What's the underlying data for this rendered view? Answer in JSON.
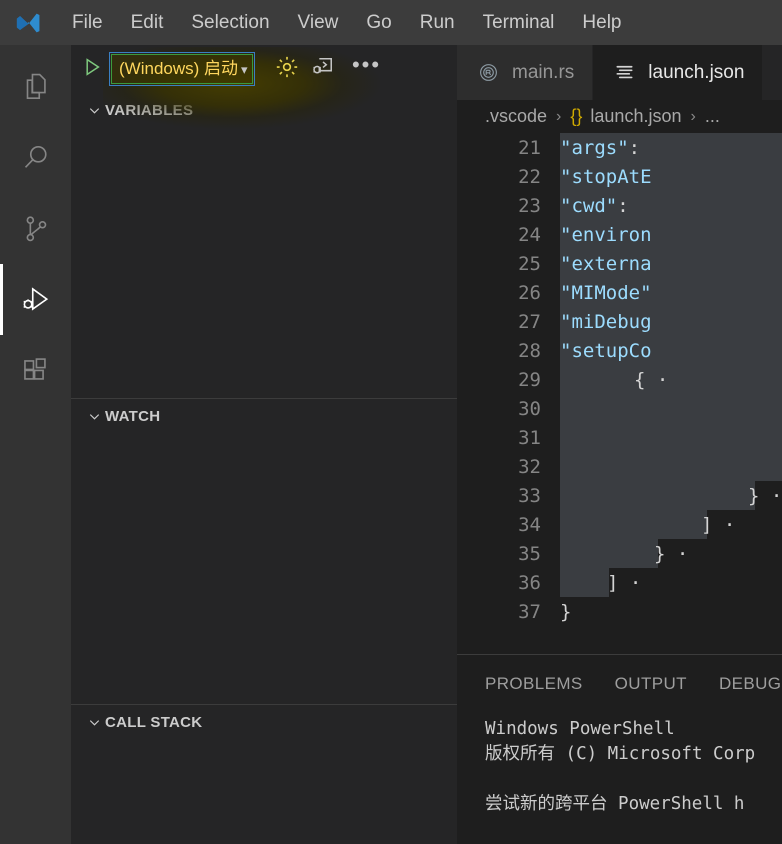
{
  "window": {
    "logo_icon": "vscode-logo-icon"
  },
  "menubar": {
    "items": [
      {
        "label": "File"
      },
      {
        "label": "Edit"
      },
      {
        "label": "Selection"
      },
      {
        "label": "View"
      },
      {
        "label": "Go"
      },
      {
        "label": "Run"
      },
      {
        "label": "Terminal"
      },
      {
        "label": "Help"
      }
    ]
  },
  "activitybar": {
    "items": [
      {
        "name": "explorer",
        "icon": "files-icon",
        "active": false
      },
      {
        "name": "search",
        "icon": "search-icon",
        "active": false
      },
      {
        "name": "source-control",
        "icon": "source-control-icon",
        "active": false
      },
      {
        "name": "run-and-debug",
        "icon": "run-debug-icon",
        "active": true
      },
      {
        "name": "extensions",
        "icon": "extensions-icon",
        "active": false
      }
    ]
  },
  "debug_toolbar": {
    "start_icon": "start-debugging-play-icon",
    "config_label": "(Windows) 启动",
    "caret_icon": "chevron-down-icon",
    "gear_icon": "gear-icon",
    "debug_console_icon": "open-debug-console-icon",
    "more_label": "•••",
    "focus_border_color": "#3a7fc4",
    "select_border_color": "#3c9a3c",
    "select_text_color": "#ffd75e",
    "gear_color": "#e8d44d"
  },
  "sidebar": {
    "sections": [
      {
        "title": "VARIABLES",
        "expanded": true,
        "chevron": "chevron-down-icon"
      },
      {
        "title": "WATCH",
        "expanded": true,
        "chevron": "chevron-down-icon"
      },
      {
        "title": "CALL STACK",
        "expanded": true,
        "chevron": "chevron-down-icon"
      }
    ]
  },
  "editor": {
    "tabs": [
      {
        "label": "main.rs",
        "icon": "rust-file-icon",
        "active": false
      },
      {
        "label": "launch.json",
        "icon": "json-file-icon",
        "active": true
      }
    ],
    "breadcrumb": {
      "folder": ".vscode",
      "sep1": "›",
      "json_icon": "{}",
      "file": "launch.json",
      "sep2": "›",
      "tail": "..."
    },
    "first_line_number": 21,
    "lines": [
      {
        "n": 21,
        "indent": 12,
        "key": "\"args\"",
        "after": ":"
      },
      {
        "n": 22,
        "indent": 12,
        "key": "\"stopAtE",
        "after": ""
      },
      {
        "n": 23,
        "indent": 12,
        "key": "\"cwd\"",
        "after": ":  "
      },
      {
        "n": 24,
        "indent": 12,
        "key": "\"environ",
        "after": ""
      },
      {
        "n": 25,
        "indent": 12,
        "key": "\"externa",
        "after": ""
      },
      {
        "n": 26,
        "indent": 12,
        "key": "\"MIMode\"",
        "after": ""
      },
      {
        "n": 27,
        "indent": 12,
        "key": "\"miDebug",
        "after": ""
      },
      {
        "n": 28,
        "indent": 12,
        "key": "\"setupCo",
        "after": ""
      },
      {
        "n": 29,
        "indent": 16,
        "key": "",
        "after": "{ ·"
      },
      {
        "n": 30,
        "indent": 0,
        "key": "",
        "after": ""
      },
      {
        "n": 31,
        "indent": 0,
        "key": "",
        "after": ""
      },
      {
        "n": 32,
        "indent": 0,
        "key": "",
        "after": ""
      },
      {
        "n": 33,
        "indent": 16,
        "key": "",
        "after": "} ·"
      },
      {
        "n": 34,
        "indent": 12,
        "key": "",
        "after": "] ·"
      },
      {
        "n": 35,
        "indent": 8,
        "key": "",
        "after": "} ·"
      },
      {
        "n": 36,
        "indent": 4,
        "key": "",
        "after": "] ·"
      },
      {
        "n": 37,
        "indent": 0,
        "key": "",
        "after": "}"
      }
    ]
  },
  "panel": {
    "tabs": [
      {
        "label": "PROBLEMS",
        "active": false
      },
      {
        "label": "OUTPUT",
        "active": false
      },
      {
        "label": "DEBUG CONSOLE",
        "active": false
      }
    ],
    "terminal_lines": [
      "Windows PowerShell",
      "版权所有 (C) Microsoft Corp",
      "",
      "尝试新的跨平台 PowerShell h"
    ]
  }
}
